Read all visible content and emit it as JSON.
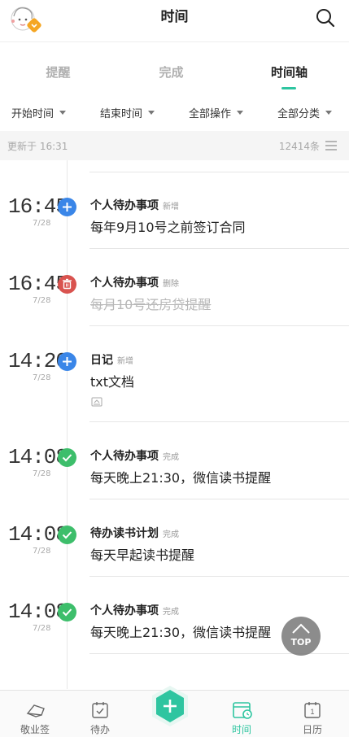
{
  "header": {
    "title": "时间"
  },
  "tabs": [
    {
      "label": "提醒",
      "active": false
    },
    {
      "label": "完成",
      "active": false
    },
    {
      "label": "时间轴",
      "active": true
    }
  ],
  "filters": [
    "开始时间",
    "结束时间",
    "全部操作",
    "全部分类"
  ],
  "status": {
    "updated": "更新于 16:31",
    "count": "12414条"
  },
  "entries": [
    {
      "time": "16:45",
      "date": "7/28",
      "action": "add",
      "category": "个人待办事项",
      "op": "新增",
      "text": "每年9月10号之前签订合同",
      "struck": false
    },
    {
      "time": "16:45",
      "date": "7/28",
      "action": "delete",
      "category": "个人待办事项",
      "op": "删除",
      "text": "每月10号还房贷提醒",
      "struck": true
    },
    {
      "time": "14:20",
      "date": "7/28",
      "action": "add",
      "category": "日记",
      "op": "新增",
      "text": "txt文档",
      "struck": false,
      "attachment": true
    },
    {
      "time": "14:08",
      "date": "7/28",
      "action": "complete",
      "category": "个人待办事项",
      "op": "完成",
      "text": "每天晚上21:30，微信读书提醒",
      "struck": false
    },
    {
      "time": "14:08",
      "date": "7/28",
      "action": "complete",
      "category": "待办读书计划",
      "op": "完成",
      "text": "每天早起读书提醒",
      "struck": false
    },
    {
      "time": "14:08",
      "date": "7/28",
      "action": "complete",
      "category": "个人待办事项",
      "op": "完成",
      "text": "每天晚上21:30，微信读书提醒",
      "struck": false
    }
  ],
  "top_button": {
    "label": "TOP"
  },
  "bottom_nav": [
    {
      "label": "敬业签",
      "icon": "cloud-paper-icon",
      "active": false
    },
    {
      "label": "待办",
      "icon": "checkbox-icon",
      "active": false
    },
    {
      "label": "",
      "icon": "add-icon",
      "active": false
    },
    {
      "label": "时间",
      "icon": "calendar-clock-icon",
      "active": true
    },
    {
      "label": "日历",
      "icon": "calendar-icon",
      "active": false
    }
  ],
  "colors": {
    "accent": "#2ec5a0",
    "add": "#3a86e8",
    "delete": "#d9534f",
    "complete": "#3dbe6b"
  }
}
